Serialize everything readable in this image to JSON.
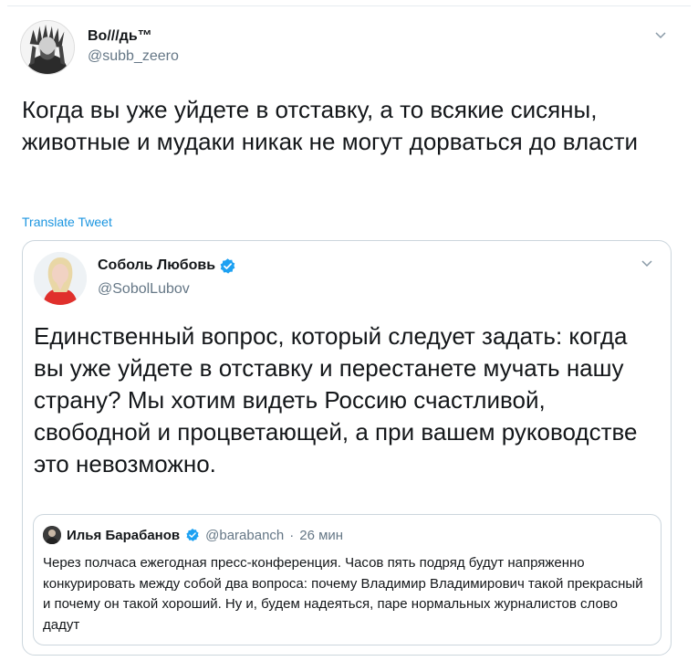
{
  "tweet": {
    "author": {
      "display_name": "Во///дь™",
      "handle": "@subb_zeero",
      "avatar_icon": "portrait-avatar-icon"
    },
    "menu_icon": "chevron-down-icon",
    "text": "Когда вы уже уйдете в отставку, а то всякие сисяны, животные и мудаки никак не могут дорваться до власти",
    "translate_label": "Translate Tweet"
  },
  "quoted_tweet": {
    "author": {
      "display_name": "Соболь Любовь",
      "handle": "@SobolLubov",
      "verified_icon": "verified-badge-icon"
    },
    "text": "Единственный вопрос, который следует задать: когда вы уже уйдете в отставку и перестанете мучать нашу страну? Мы хотим видеть Россию счастливой, свободной и процветающей, а при вашем руководстве это невозможно."
  },
  "nested_quote": {
    "author": {
      "display_name": "Илья Барабанов",
      "handle": "@barabanch",
      "separator": "·",
      "time": "26 мин"
    },
    "text": "Через полчаса ежегодная пресс-конференция. Часов пять подряд  будут напряженно конкурировать между собой два вопроса: почему Владимир Владимирович такой прекрасный и почему он такой хороший. Ну и, будем надеяться, паре нормальных журналистов слово дадут"
  },
  "colors": {
    "link": "#1b95e0",
    "verified": "#1da1f2",
    "muted": "#657786",
    "border": "#ccd6dd"
  }
}
